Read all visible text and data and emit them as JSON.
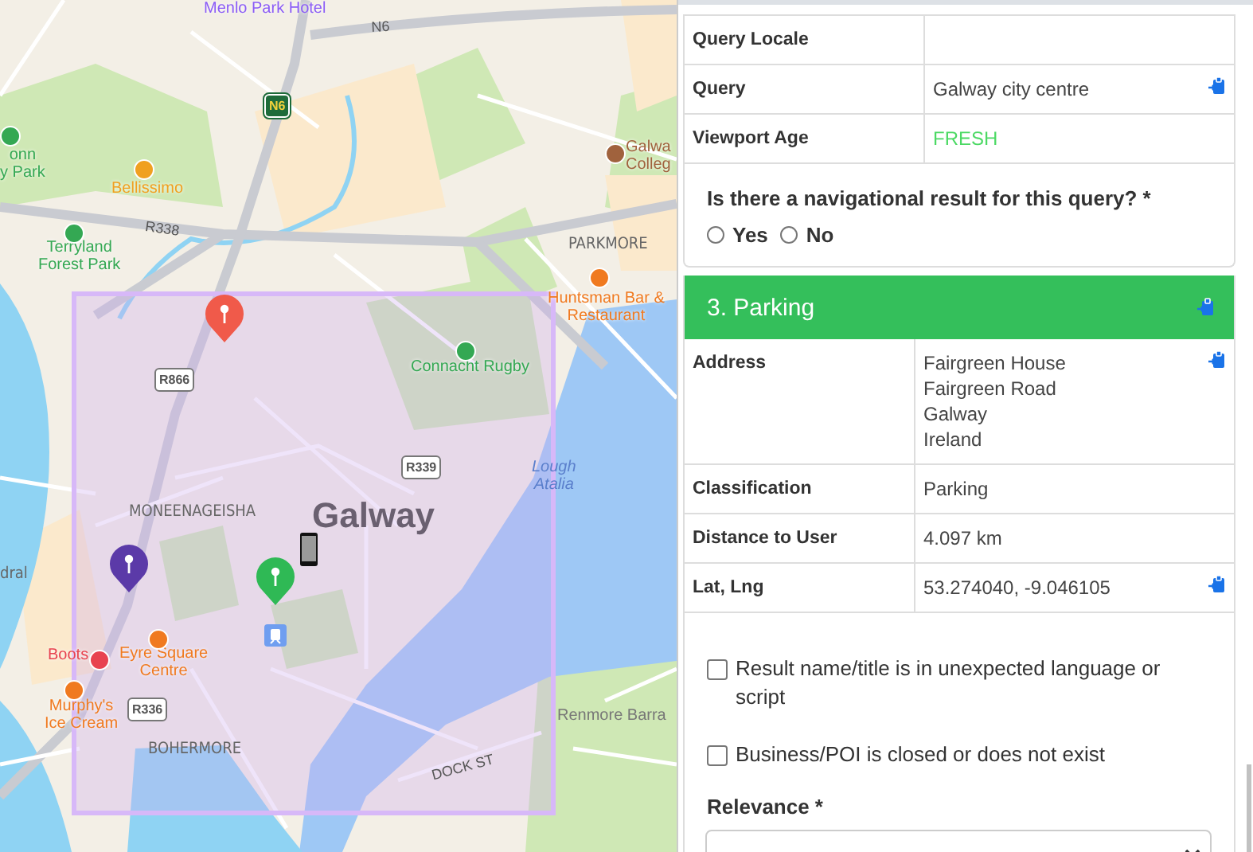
{
  "map": {
    "labels": [
      {
        "text": "Menlo Park Hotel",
        "kind": "poi",
        "color": "#8b5cf6"
      },
      {
        "text": "N6",
        "kind": "road"
      },
      {
        "text": "N6",
        "kind": "national-shield"
      },
      {
        "text": "onn\ny Park",
        "kind": "poi",
        "color": "#34a853"
      },
      {
        "text": "Bellissimo",
        "kind": "poi",
        "color": "#f0a020"
      },
      {
        "text": "R338",
        "kind": "road"
      },
      {
        "text": "Terryland\nForest Park",
        "kind": "poi",
        "color": "#34a853"
      },
      {
        "text": "Galwa\nColleg",
        "kind": "poi",
        "color": "#a0623d"
      },
      {
        "text": "PARKMORE",
        "kind": "district"
      },
      {
        "text": "Huntsman Bar &\nRestaurant",
        "kind": "poi",
        "color": "#f07a20"
      },
      {
        "text": "Connacht Rugby",
        "kind": "poi",
        "color": "#34a853"
      },
      {
        "text": "R866",
        "kind": "shield"
      },
      {
        "text": "R339",
        "kind": "shield"
      },
      {
        "text": "Lough\nAtalia",
        "kind": "water"
      },
      {
        "text": "MONEENAGEISHA",
        "kind": "district"
      },
      {
        "text": "Galway",
        "kind": "city"
      },
      {
        "text": "dral",
        "kind": "district"
      },
      {
        "text": "Boots",
        "kind": "poi",
        "color": "#e8434f"
      },
      {
        "text": "Eyre Square\nCentre",
        "kind": "poi",
        "color": "#f07a20"
      },
      {
        "text": "Murphy's\nIce Cream",
        "kind": "poi",
        "color": "#f07a20"
      },
      {
        "text": "R336",
        "kind": "shield"
      },
      {
        "text": "BOHERMORE",
        "kind": "district"
      },
      {
        "text": "Renmore Barra",
        "kind": "place"
      },
      {
        "text": "DOCK ST",
        "kind": "road"
      }
    ],
    "pins": [
      {
        "color": "#f05a4a"
      },
      {
        "color": "#5b3aa8"
      },
      {
        "color": "#2fb955"
      }
    ]
  },
  "query_table": {
    "rows": [
      {
        "label": "Query Locale",
        "value": "",
        "copy": false
      },
      {
        "label": "Query",
        "value": "Galway city centre",
        "copy": true
      },
      {
        "label": "Viewport Age",
        "value": "FRESH",
        "copy": false,
        "color": "#4cd964"
      }
    ]
  },
  "question": {
    "text": "Is there a navigational result for this query? *",
    "options": [
      {
        "label": "Yes",
        "selected": false
      },
      {
        "label": "No",
        "selected": false
      }
    ]
  },
  "result": {
    "title": "3. Parking",
    "copy": true,
    "rows": [
      {
        "label": "Address",
        "lines": [
          "Fairgreen House",
          "Fairgreen Road",
          "Galway",
          "Ireland"
        ],
        "copy": true
      },
      {
        "label": "Classification",
        "lines": [
          "Parking"
        ],
        "copy": false
      },
      {
        "label": "Distance to User",
        "lines": [
          "4.097 km"
        ],
        "copy": false
      },
      {
        "label": "Lat, Lng",
        "lines": [
          "53.274040, -9.046105"
        ],
        "copy": true
      }
    ],
    "checks": [
      {
        "label": "Result name/title is in unexpected language or script",
        "checked": false
      },
      {
        "label": "Business/POI is closed or does not exist",
        "checked": false
      }
    ],
    "relevance": {
      "label": "Relevance *"
    }
  }
}
